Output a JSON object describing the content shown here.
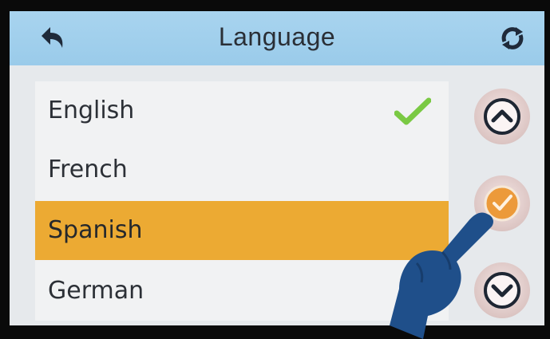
{
  "header": {
    "title": "Language",
    "back_icon": "back-arrow-icon",
    "refresh_icon": "refresh-icon"
  },
  "language_list": {
    "items": [
      {
        "label": "English",
        "checked": true,
        "selected": false
      },
      {
        "label": "French",
        "checked": false,
        "selected": false
      },
      {
        "label": "Spanish",
        "checked": false,
        "selected": true
      },
      {
        "label": "German",
        "checked": false,
        "selected": false
      }
    ]
  },
  "side_controls": {
    "up_icon": "chevron-up-icon",
    "confirm_icon": "confirm-check-icon",
    "down_icon": "chevron-down-icon"
  },
  "colors": {
    "header_bg": "#9acbea",
    "selected_row": "#ecaa33",
    "checkmark": "#7ac943",
    "confirm_accent": "#ec9a3a",
    "hand_pointer": "#1f4f8a"
  }
}
